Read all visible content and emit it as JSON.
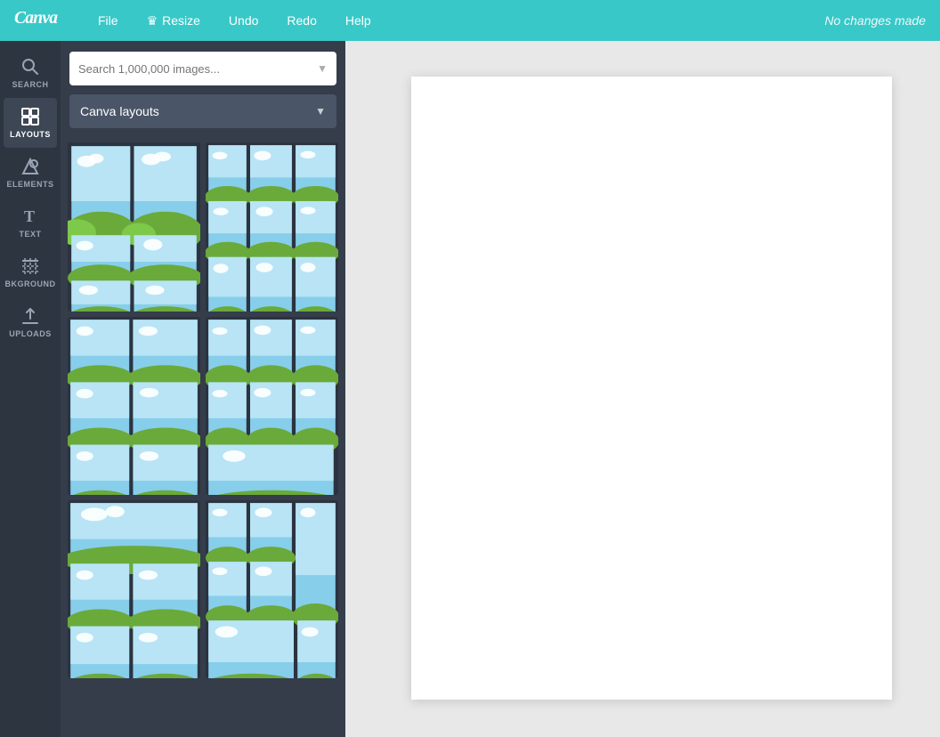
{
  "topbar": {
    "logo": "Canva",
    "nav": [
      "File",
      "Resize",
      "Undo",
      "Redo",
      "Help"
    ],
    "resize_label": "Resize",
    "status": "No changes made"
  },
  "sidebar": {
    "items": [
      {
        "id": "search",
        "label": "SEARCH",
        "icon": "search"
      },
      {
        "id": "layouts",
        "label": "LAYOUTS",
        "icon": "layouts",
        "active": true
      },
      {
        "id": "elements",
        "label": "ELEMENTS",
        "icon": "elements"
      },
      {
        "id": "text",
        "label": "TEXT",
        "icon": "text"
      },
      {
        "id": "background",
        "label": "BKGROUND",
        "icon": "background"
      },
      {
        "id": "uploads",
        "label": "UPLOADS",
        "icon": "uploads"
      }
    ]
  },
  "panel": {
    "search_placeholder": "Search 1,000,000 images...",
    "dropdown_label": "Canva layouts"
  }
}
